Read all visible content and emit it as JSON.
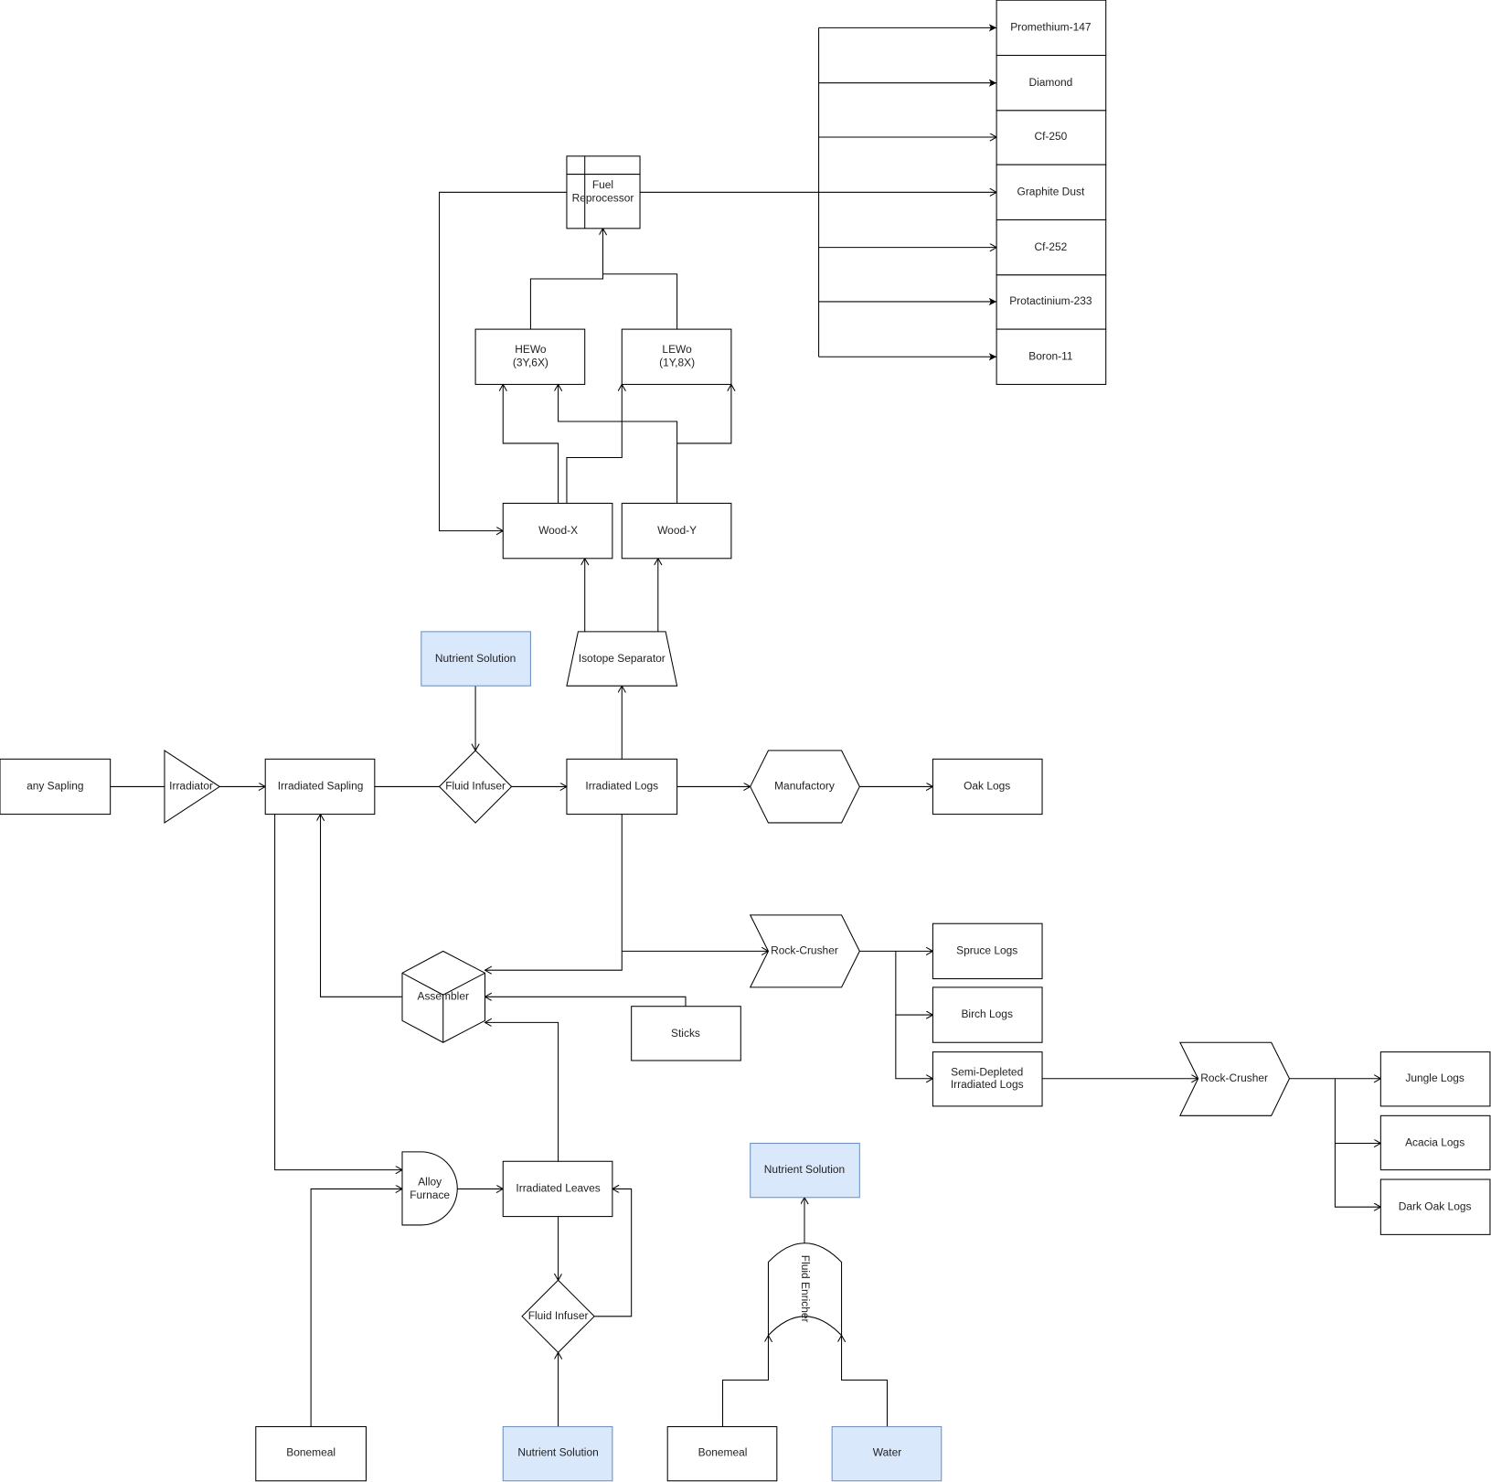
{
  "outputs": [
    "Promethium-147",
    "Diamond",
    "Cf-250",
    "Graphite Dust",
    "Cf-252",
    "Protactinium-233",
    "Boron-11"
  ],
  "fuel_reprocessor": [
    "Fuel",
    "Reprocessor"
  ],
  "hewo": [
    "HEWo",
    "(3Y,6X)"
  ],
  "lewo": [
    "LEWo",
    "(1Y,8X)"
  ],
  "wood_x": "Wood-X",
  "wood_y": "Wood-Y",
  "isotope_separator": "Isotope Separator",
  "nutrient_solution": "Nutrient Solution",
  "fluid_infuser": "Fluid Infuser",
  "any_sapling": "any Sapling",
  "irradiator": "Irradiator",
  "irradiated_sapling": "Irradiated Sapling",
  "irradiated_logs": "Irradiated Logs",
  "manufactory": "Manufactory",
  "oak_logs": "Oak Logs",
  "rock_crusher": "Rock-Crusher",
  "spruce_logs": "Spruce Logs",
  "birch_logs": "Birch Logs",
  "semi_depleted": [
    "Semi-Depleted",
    "Irradiated Logs"
  ],
  "jungle_logs": "Jungle Logs",
  "acacia_logs": "Acacia Logs",
  "dark_oak_logs": "Dark Oak Logs",
  "assembler": "Assembler",
  "sticks": "Sticks",
  "alloy_furnace": [
    "Alloy",
    "Furnace"
  ],
  "irradiated_leaves": "Irradiated Leaves",
  "bonemeal": "Bonemeal",
  "water": "Water",
  "fluid_enricher": "Fluid Enricher",
  "colors": {
    "input_fill": "#dae8fc",
    "input_stroke": "#6c8ebf",
    "stroke": "#000000"
  }
}
